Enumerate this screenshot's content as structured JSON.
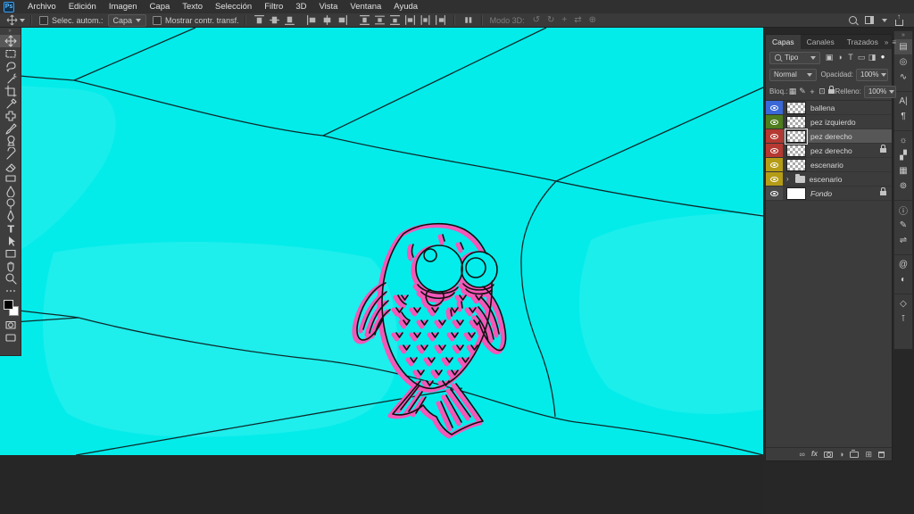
{
  "app": {
    "logo_text": "Ps"
  },
  "menu_bar": {
    "items": [
      "Archivo",
      "Edición",
      "Imagen",
      "Capa",
      "Texto",
      "Selección",
      "Filtro",
      "3D",
      "Vista",
      "Ventana",
      "Ayuda"
    ]
  },
  "options_bar": {
    "auto_select": {
      "label": "Selec. autom.:",
      "value": "Capa",
      "checked": false
    },
    "show_transform": {
      "label": "Mostrar contr. transf.",
      "checked": false
    },
    "mode3d_label": "Modo 3D:",
    "mode3d_icons": [
      {
        "name": "3d-orbit-icon",
        "glyph": "↺"
      },
      {
        "name": "3d-roll-icon",
        "glyph": "↻"
      },
      {
        "name": "3d-pan-icon",
        "glyph": "+"
      },
      {
        "name": "3d-slide-icon",
        "glyph": "⇄"
      },
      {
        "name": "3d-zoom-icon",
        "glyph": "⊕"
      }
    ]
  },
  "toolbar": {
    "selected_tool": "move"
  },
  "layers_panel": {
    "tabs": [
      {
        "label": "Capas",
        "active": true
      },
      {
        "label": "Canales",
        "active": false
      },
      {
        "label": "Trazados",
        "active": false
      }
    ],
    "filter": {
      "label": "Tipo",
      "icons": [
        {
          "name": "filter-pixel-icon",
          "glyph": "▣"
        },
        {
          "name": "filter-adjustment-icon",
          "glyph": "◑"
        },
        {
          "name": "filter-type-icon",
          "glyph": "T"
        },
        {
          "name": "filter-shape-icon",
          "glyph": "▭"
        },
        {
          "name": "filter-smart-icon",
          "glyph": "◨"
        },
        {
          "name": "filter-toggle-icon",
          "glyph": "●"
        }
      ]
    },
    "blend": {
      "value": "Normal",
      "opacity_label": "Opacidad:",
      "opacity": "100%"
    },
    "lock": {
      "label": "Bloq.:",
      "fill_label": "Relleno:",
      "fill": "100%",
      "icons": [
        {
          "name": "lock-transparency-icon",
          "glyph": "▦"
        },
        {
          "name": "lock-paint-icon",
          "glyph": "✎"
        },
        {
          "name": "lock-position-icon",
          "glyph": "+"
        },
        {
          "name": "lock-artboard-icon",
          "glyph": "⊡"
        },
        {
          "name": "lock-all-icon",
          "glyph": "css-lock"
        }
      ]
    },
    "layers": [
      {
        "name": "ballena",
        "color": "#3a68d7",
        "kind": "pixel",
        "selected": false,
        "locked": false,
        "italic": false
      },
      {
        "name": "pez izquierdo",
        "color": "#4e7d1d",
        "kind": "pixel",
        "selected": false,
        "locked": false,
        "italic": false
      },
      {
        "name": "pez derecho",
        "color": "#b53831",
        "kind": "pixel",
        "selected": true,
        "locked": false,
        "italic": false
      },
      {
        "name": "pez derecho",
        "color": "#b53831",
        "kind": "pixel",
        "selected": false,
        "locked": true,
        "italic": false
      },
      {
        "name": "escenario",
        "color": "#b59c17",
        "kind": "pixel",
        "selected": false,
        "locked": false,
        "italic": false
      },
      {
        "name": "escenario",
        "color": "#b59c17",
        "kind": "group",
        "selected": false,
        "locked": false,
        "italic": false
      },
      {
        "name": "Fondo",
        "color": "#4a4a4a",
        "kind": "background",
        "selected": false,
        "locked": true,
        "italic": true
      }
    ],
    "footer_icons": [
      {
        "name": "link-layers-icon",
        "glyph": "∞"
      },
      {
        "name": "layer-effects-icon",
        "glyph": "fx"
      },
      {
        "name": "add-mask-icon",
        "glyph": "css-mask"
      },
      {
        "name": "new-adjustment-icon",
        "glyph": "◑"
      },
      {
        "name": "new-group-icon",
        "glyph": "css-folder"
      },
      {
        "name": "new-layer-icon",
        "glyph": "⊞"
      },
      {
        "name": "delete-layer-icon",
        "glyph": "css-trash"
      }
    ]
  },
  "dock": {
    "icons": [
      {
        "name": "dock-layers-icon",
        "glyph": "▤",
        "active": true,
        "sep": false
      },
      {
        "name": "dock-channels-icon",
        "glyph": "◎",
        "active": false,
        "sep": false
      },
      {
        "name": "dock-paths-icon",
        "glyph": "∿",
        "active": false,
        "sep": false
      },
      {
        "name": "dock-character-icon",
        "glyph": "A|",
        "active": false,
        "sep": true
      },
      {
        "name": "dock-paragraph-icon",
        "glyph": "¶",
        "active": false,
        "sep": false
      },
      {
        "name": "dock-adjustments-icon",
        "glyph": "☼",
        "active": false,
        "sep": true
      },
      {
        "name": "dock-styles-icon",
        "glyph": "▞",
        "active": false,
        "sep": false
      },
      {
        "name": "dock-patterns-icon",
        "glyph": "▦",
        "active": false,
        "sep": false
      },
      {
        "name": "dock-color-icon",
        "glyph": "⊚",
        "active": false,
        "sep": false
      },
      {
        "name": "dock-info-icon",
        "glyph": "ⓘ",
        "active": false,
        "sep": true
      },
      {
        "name": "dock-brush-settings-icon",
        "glyph": "✎",
        "active": false,
        "sep": false
      },
      {
        "name": "dock-properties-icon",
        "glyph": "⇌",
        "active": false,
        "sep": false
      },
      {
        "name": "dock-libraries-icon",
        "glyph": "@",
        "active": false,
        "sep": true
      },
      {
        "name": "dock-masks-icon",
        "glyph": "◐",
        "active": false,
        "sep": false
      },
      {
        "name": "dock-3d-icon",
        "glyph": "◇",
        "active": false,
        "sep": true
      },
      {
        "name": "dock-measure-icon",
        "glyph": "⊺",
        "active": false,
        "sep": false
      }
    ]
  },
  "colors": {
    "canvas_cyan": "#03ecea",
    "canvas_cyan_light": "rgba(255,255,255,0.11)",
    "crack_line": "#0e2a2b",
    "fish_pink": "#f457b8",
    "fish_line": "#101010",
    "accent_blue": "#3ba0f2"
  }
}
